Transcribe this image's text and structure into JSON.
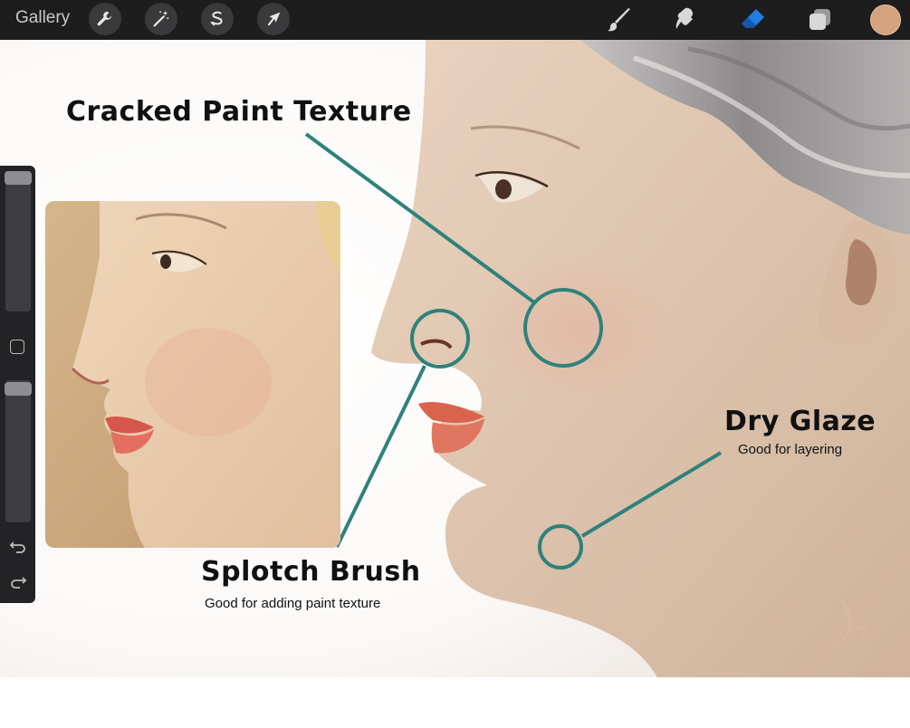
{
  "toolbar": {
    "gallery_label": "Gallery",
    "left_tools": [
      "wrench-icon",
      "magic-wand-icon",
      "selection-icon",
      "transform-arrow-icon"
    ],
    "right_tools": [
      "brush-icon",
      "smudge-icon",
      "eraser-icon",
      "layers-icon"
    ],
    "active_tool": "eraser-icon",
    "current_color": "#d6a17e",
    "accent_color": "#1f7de3"
  },
  "annotations": {
    "cracked": {
      "title": "Cracked Paint Texture"
    },
    "splotch": {
      "title": "Splotch Brush",
      "subtitle": "Good for adding paint texture"
    },
    "dry": {
      "title": "Dry Glaze",
      "subtitle": "Good for layering"
    },
    "line_color": "#2e827b"
  }
}
